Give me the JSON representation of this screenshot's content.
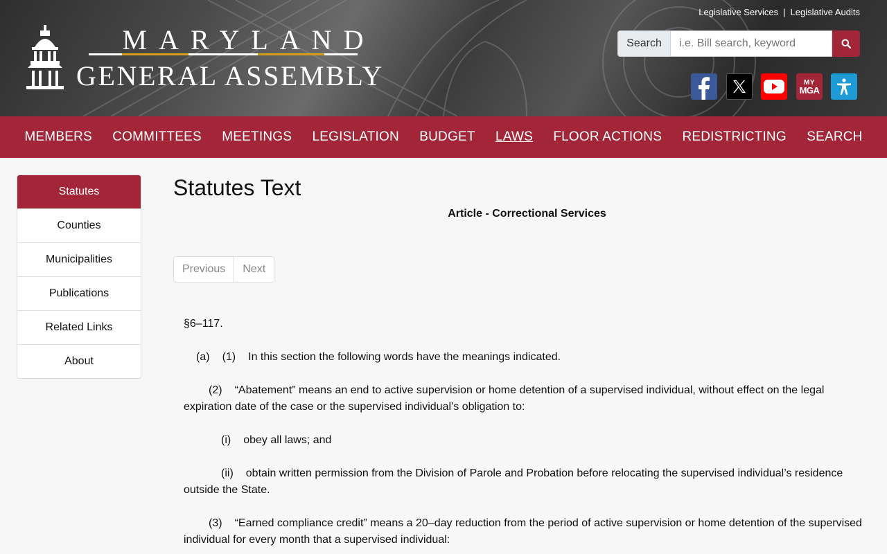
{
  "header": {
    "site_title_line1": "MARYLAND",
    "site_title_line2": "GENERAL ASSEMBLY",
    "top_links": [
      "Legislative Services",
      "Legislative Audits"
    ],
    "top_links_separator": "|",
    "search": {
      "label": "Search",
      "placeholder": "i.e. Bill search, keyword",
      "button_icon": "search-icon"
    },
    "social": [
      {
        "name": "facebook-icon"
      },
      {
        "name": "x-icon"
      },
      {
        "name": "youtube-icon"
      },
      {
        "name": "mymga-icon",
        "text_top": "MY",
        "text_bottom": "MGA"
      },
      {
        "name": "accessibility-icon"
      }
    ]
  },
  "nav": {
    "items": [
      "MEMBERS",
      "COMMITTEES",
      "MEETINGS",
      "LEGISLATION",
      "BUDGET",
      "LAWS",
      "FLOOR ACTIONS",
      "REDISTRICTING",
      "SEARCH"
    ],
    "active": "LAWS"
  },
  "sidebar": {
    "items": [
      "Statutes",
      "Counties",
      "Municipalities",
      "Publications",
      "Related Links",
      "About"
    ],
    "active": "Statutes"
  },
  "main": {
    "title": "Statutes Text",
    "article": "Article - Correctional Services",
    "pager": {
      "previous": "Previous",
      "next": "Next"
    },
    "section": "§6–117.",
    "paragraphs": {
      "a1_label_a": "(a)",
      "a1_label_1": "(1)",
      "a1_text": "In this section the following words have the meanings indicated.",
      "p2_label": "(2)",
      "p2_text": "“Abatement” means an end to active supervision or home detention of a supervised individual, without effect on the legal expiration date of the case or the supervised individual’s obligation to:",
      "pi_label": "(i)",
      "pi_text": "obey all laws; and",
      "pii_label": "(ii)",
      "pii_text": "obtain written permission from the Division of Parole and Probation before relocating the supervised individual’s residence outside the State.",
      "p3_label": "(3)",
      "p3_text": "“Earned compliance credit” means a 20–day reduction from the period of active supervision or home detention of the supervised individual for every month that a supervised individual:"
    }
  },
  "colors": {
    "brand": "#a32638",
    "nav_text": "#ffffff",
    "page_bg": "#f7f7f7"
  }
}
